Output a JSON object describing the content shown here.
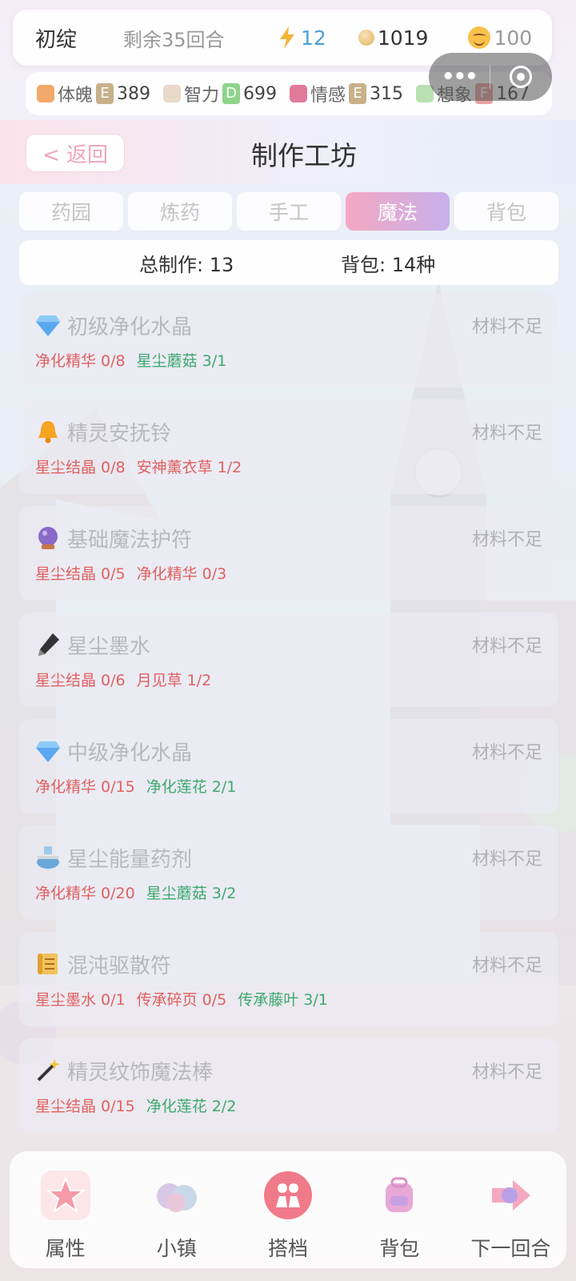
{
  "player": {
    "name": "初绽",
    "turns_left": "剩余35回合",
    "energy": "12",
    "gold": "1019",
    "mood": "100"
  },
  "attributes": [
    {
      "name": "体魄",
      "grade": "E",
      "value": "389",
      "grade_color": "#c8b08a",
      "icon_color": "#f2a86a"
    },
    {
      "name": "智力",
      "grade": "D",
      "value": "699",
      "grade_color": "#8ed48a",
      "icon_color": "#e8d8c8"
    },
    {
      "name": "情感",
      "grade": "E",
      "value": "315",
      "grade_color": "#c8b08a",
      "icon_color": "#e07a9a"
    },
    {
      "name": "想象",
      "grade": "F",
      "value": "167",
      "grade_color": "#e8a0a0",
      "icon_color": "#b8e0b0"
    }
  ],
  "header": {
    "back_label": "< 返回",
    "title": "制作工坊"
  },
  "tabs": [
    {
      "label": "药园",
      "active": false
    },
    {
      "label": "炼药",
      "active": false
    },
    {
      "label": "手工",
      "active": false
    },
    {
      "label": "魔法",
      "active": true
    },
    {
      "label": "背包",
      "active": false
    }
  ],
  "summary": {
    "total": "总制作: 13",
    "bag": "背包: 14种"
  },
  "recipes": [
    {
      "icon": "diamond-icon",
      "name": "初级净化水晶",
      "status": "材料不足",
      "materials": [
        {
          "text": "净化精华 0/8",
          "ok": false
        },
        {
          "text": "星尘蘑菇 3/1",
          "ok": true
        }
      ]
    },
    {
      "icon": "bell-icon",
      "name": "精灵安抚铃",
      "status": "材料不足",
      "materials": [
        {
          "text": "星尘结晶 0/8",
          "ok": false
        },
        {
          "text": "安神薰衣草 1/2",
          "ok": false
        }
      ]
    },
    {
      "icon": "crystal-ball-icon",
      "name": "基础魔法护符",
      "status": "材料不足",
      "materials": [
        {
          "text": "星尘结晶 0/5",
          "ok": false
        },
        {
          "text": "净化精华 0/3",
          "ok": false
        }
      ]
    },
    {
      "icon": "fountain-pen-icon",
      "name": "星尘墨水",
      "status": "材料不足",
      "materials": [
        {
          "text": "星尘结晶 0/6",
          "ok": false
        },
        {
          "text": "月见草 1/2",
          "ok": false
        }
      ]
    },
    {
      "icon": "diamond-icon",
      "name": "中级净化水晶",
      "status": "材料不足",
      "materials": [
        {
          "text": "净化精华 0/15",
          "ok": false
        },
        {
          "text": "净化莲花 2/1",
          "ok": true
        }
      ]
    },
    {
      "icon": "flask-icon",
      "name": "星尘能量药剂",
      "status": "材料不足",
      "materials": [
        {
          "text": "净化精华 0/20",
          "ok": false
        },
        {
          "text": "星尘蘑菇 3/2",
          "ok": true
        }
      ]
    },
    {
      "icon": "scroll-icon",
      "name": "混沌驱散符",
      "status": "材料不足",
      "materials": [
        {
          "text": "星尘墨水 0/1",
          "ok": false
        },
        {
          "text": "传承碎页 0/5",
          "ok": false
        },
        {
          "text": "传承藤叶 3/1",
          "ok": true
        }
      ]
    },
    {
      "icon": "magic-wand-icon",
      "name": "精灵纹饰魔法棒",
      "status": "材料不足",
      "materials": [
        {
          "text": "星尘结晶 0/15",
          "ok": false
        },
        {
          "text": "净化莲花 2/2",
          "ok": true
        }
      ]
    }
  ],
  "bottom_nav": [
    {
      "label": "属性",
      "icon": "star-badge-icon"
    },
    {
      "label": "小镇",
      "icon": "town-icon"
    },
    {
      "label": "搭档",
      "icon": "partner-icon"
    },
    {
      "label": "背包",
      "icon": "backpack-icon"
    },
    {
      "label": "下一回合",
      "icon": "next-turn-icon"
    }
  ]
}
